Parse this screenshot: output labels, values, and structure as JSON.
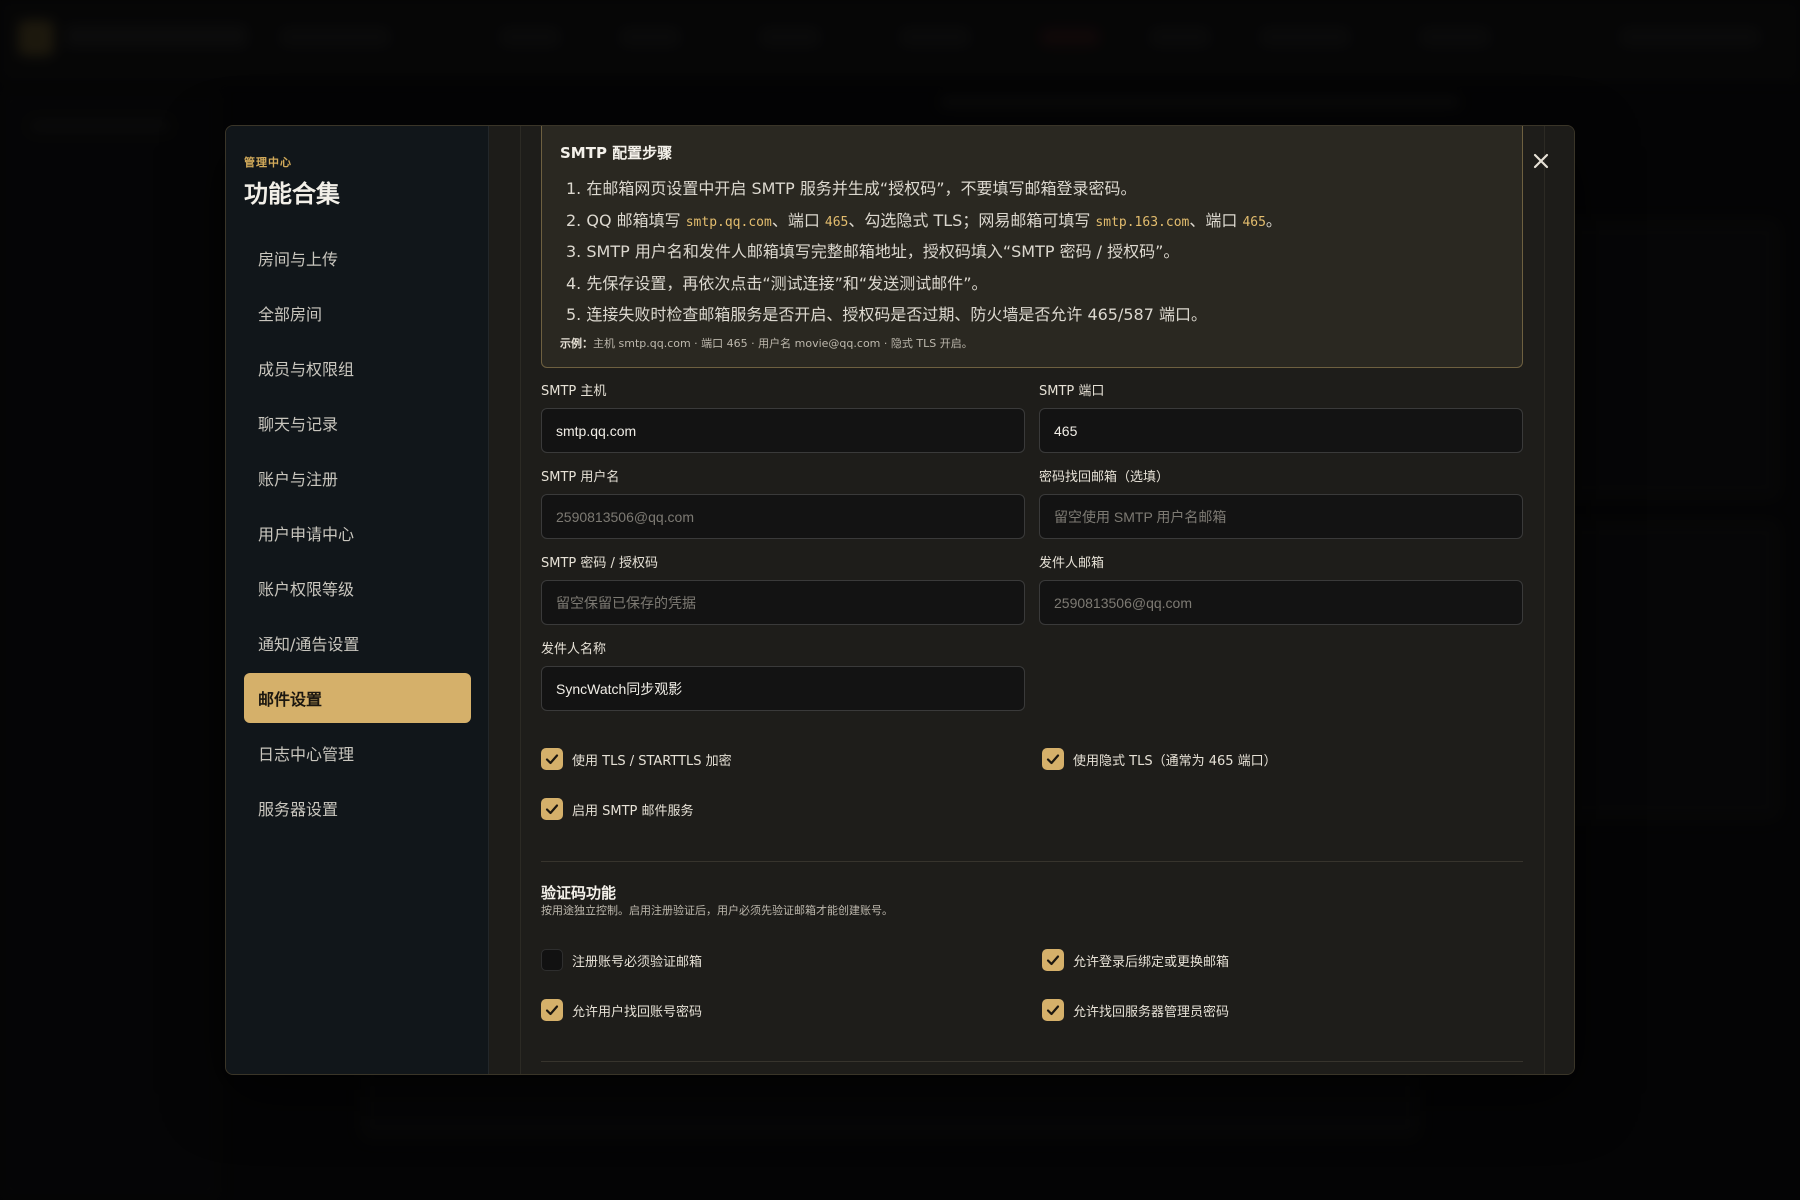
{
  "side": {
    "eyebrow": "管理中心",
    "title": "功能合集",
    "items": [
      {
        "label": "房间与上传"
      },
      {
        "label": "全部房间"
      },
      {
        "label": "成员与权限组"
      },
      {
        "label": "聊天与记录"
      },
      {
        "label": "账户与注册"
      },
      {
        "label": "用户申请中心"
      },
      {
        "label": "账户权限等级"
      },
      {
        "label": "通知/通告设置"
      },
      {
        "label": "邮件设置",
        "active": true
      },
      {
        "label": "日志中心管理"
      },
      {
        "label": "服务器设置"
      }
    ]
  },
  "steps": {
    "title": "SMTP 配置步骤",
    "step1": "1. 在邮箱网页设置中开启 SMTP 服务并生成“授权码”，不要填写邮箱登录密码。",
    "step2": {
      "a": "2. QQ 邮箱填写 ",
      "host_qq": "smtp.qq.com",
      "b": "、端口 ",
      "port1": "465",
      "c": "、勾选隐式 TLS；网易邮箱可填写 ",
      "host_163": "smtp.163.com",
      "d": "、端口 ",
      "port2": "465",
      "e": "。"
    },
    "step3": "3. SMTP 用户名和发件人邮箱填写完整邮箱地址，授权码填入“SMTP 密码 / 授权码”。",
    "step4": "4. 先保存设置，再依次点击“测试连接”和“发送测试邮件”。",
    "step5": "5. 连接失败时检查邮箱服务是否开启、授权码是否过期、防火墙是否允许 465/587 端口。",
    "example_label": "示例：",
    "example_text": "主机 smtp.qq.com · 端口 465 · 用户名 movie@qq.com · 隐式 TLS 开启。"
  },
  "form": {
    "host": {
      "label": "SMTP 主机",
      "value": "smtp.qq.com",
      "placeholder": ""
    },
    "port": {
      "label": "SMTP 端口",
      "value": "465",
      "placeholder": ""
    },
    "username": {
      "label": "SMTP 用户名",
      "value": "",
      "placeholder": "2590813506@qq.com"
    },
    "recovery": {
      "label": "密码找回邮箱（选填）",
      "value": "",
      "placeholder": "留空使用 SMTP 用户名邮箱"
    },
    "password": {
      "label": "SMTP 密码 / 授权码",
      "value": "",
      "placeholder": "留空保留已保存的凭据"
    },
    "sender": {
      "label": "发件人邮箱",
      "value": "",
      "placeholder": "2590813506@qq.com"
    },
    "sender_name": {
      "label": "发件人名称",
      "value": "SyncWatch同步观影",
      "placeholder": ""
    }
  },
  "checks": {
    "tls": {
      "label": "使用 TLS / STARTTLS 加密",
      "checked": true
    },
    "implicit_tls": {
      "label": "使用隐式 TLS（通常为 465 端口）",
      "checked": true
    },
    "enable_smtp": {
      "label": "启用 SMTP 邮件服务",
      "checked": true
    }
  },
  "verify": {
    "title": "验证码功能",
    "desc": "按用途独立控制。启用注册验证后，用户必须先验证邮箱才能创建账号。",
    "require_email": {
      "label": "注册账号必须验证邮箱",
      "checked": false
    },
    "bind_email": {
      "label": "允许登录后绑定或更换邮箱",
      "checked": true
    },
    "user_reset": {
      "label": "允许用户找回账号密码",
      "checked": true
    },
    "admin_reset": {
      "label": "允许找回服务器管理员密码",
      "checked": true
    }
  },
  "colors": {
    "accent": "#d5b06a",
    "panel": "#1e1d1a",
    "sidebar": "#11161a"
  }
}
